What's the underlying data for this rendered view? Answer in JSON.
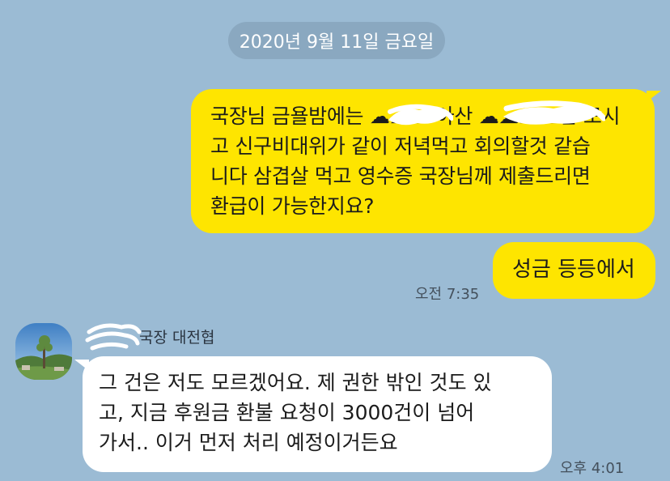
{
  "date_divider": "2020년 9월 11일 금요일",
  "messages": [
    {
      "direction": "outgoing",
      "lines": [
        "국장님 금욜밤에는 ☁☁☁ 아산 ☁☁☁☁님 모시",
        "고 신구비대위가 같이 저녁먹고 회의할것 같습",
        "니다 삼겹살 먹고 영수증 국장님께 제출드리면",
        "환급이 가능한지요?"
      ]
    },
    {
      "direction": "outgoing",
      "lines": [
        "성금 등등에서"
      ],
      "time": "오전 7:35"
    },
    {
      "direction": "incoming",
      "sender": "국장 대전협",
      "lines": [
        "그 건은 저도 모르겠어요. 제 권한 밖인 것도 있",
        "고, 지금 후원금 환불 요청이 3000건이 넘어",
        "가서.. 이거 먼저 처리 예정이거든요"
      ],
      "time": "오후 4:01"
    }
  ],
  "colors": {
    "background": "#9bbbd4",
    "outgoing_bubble": "#fee500",
    "incoming_bubble": "#ffffff",
    "date_pill": "#8aa8c0"
  }
}
